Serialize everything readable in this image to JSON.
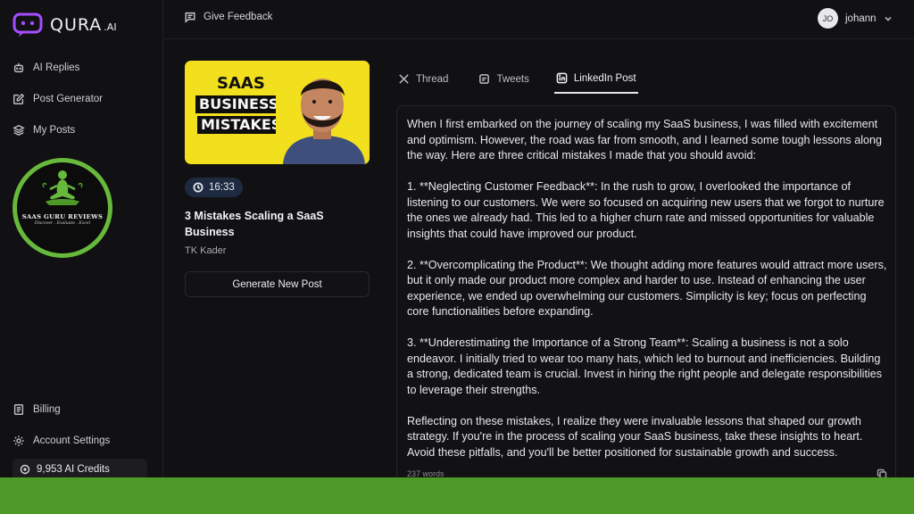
{
  "brand": {
    "name": "QURA",
    "suffix": ".AI"
  },
  "sidebar": {
    "nav": [
      {
        "label": "AI Replies",
        "icon": "ai-replies-icon"
      },
      {
        "label": "Post Generator",
        "icon": "edit-icon"
      },
      {
        "label": "My Posts",
        "icon": "layers-icon"
      }
    ],
    "badge": {
      "title": "SAAS GURU REVIEWS",
      "subtitle": "Discover . Evaluate . Excel"
    },
    "bottom": [
      {
        "label": "Billing",
        "icon": "receipt-icon"
      },
      {
        "label": "Account Settings",
        "icon": "gear-icon"
      }
    ],
    "credits": "9,953 AI Credits"
  },
  "topbar": {
    "feedback_label": "Give Feedback",
    "user": {
      "initials": "JO",
      "name": "johann"
    }
  },
  "video": {
    "thumbnail_words": [
      "SAAS",
      "BUSINESS",
      "MISTAKES"
    ],
    "duration": "16:33",
    "title": "3 Mistakes Scaling a SaaS Business",
    "author": "TK Kader",
    "generate_label": "Generate New Post"
  },
  "tabs": [
    {
      "label": "Thread",
      "icon": "x-logo-icon",
      "active": false
    },
    {
      "label": "Tweets",
      "icon": "tweets-icon",
      "active": false
    },
    {
      "label": "LinkedIn Post",
      "icon": "linkedin-icon",
      "active": true
    }
  ],
  "post": {
    "paragraphs": [
      "When I first embarked on the journey of scaling my SaaS business, I was filled with excitement and optimism. However, the road was far from smooth, and I learned some tough lessons along the way. Here are three critical mistakes I made that you should avoid:",
      "1. **Neglecting Customer Feedback**: In the rush to grow, I overlooked the importance of listening to our customers. We were so focused on acquiring new users that we forgot to nurture the ones we already had. This led to a higher churn rate and missed opportunities for valuable insights that could have improved our product.",
      "2. **Overcomplicating the Product**: We thought adding more features would attract more users, but it only made our product more complex and harder to use. Instead of enhancing the user experience, we ended up overwhelming our customers. Simplicity is key; focus on perfecting core functionalities before expanding.",
      "3. **Underestimating the Importance of a Strong Team**: Scaling a business is not a solo endeavor. I initially tried to wear too many hats, which led to burnout and inefficiencies. Building a strong, dedicated team is crucial. Invest in hiring the right people and delegate responsibilities to leverage their strengths.",
      "Reflecting on these mistakes, I realize they were invaluable lessons that shaped our growth strategy. If you're in the process of scaling your SaaS business, take these insights to heart. Avoid these pitfalls, and you'll be better positioned for sustainable growth and success."
    ],
    "word_count": "237 words"
  },
  "colors": {
    "accent_green": "#4e9a28",
    "badge_green": "#67b93c",
    "thumb_yellow": "#f2df1e",
    "pill_blue": "#1e2a3f"
  }
}
